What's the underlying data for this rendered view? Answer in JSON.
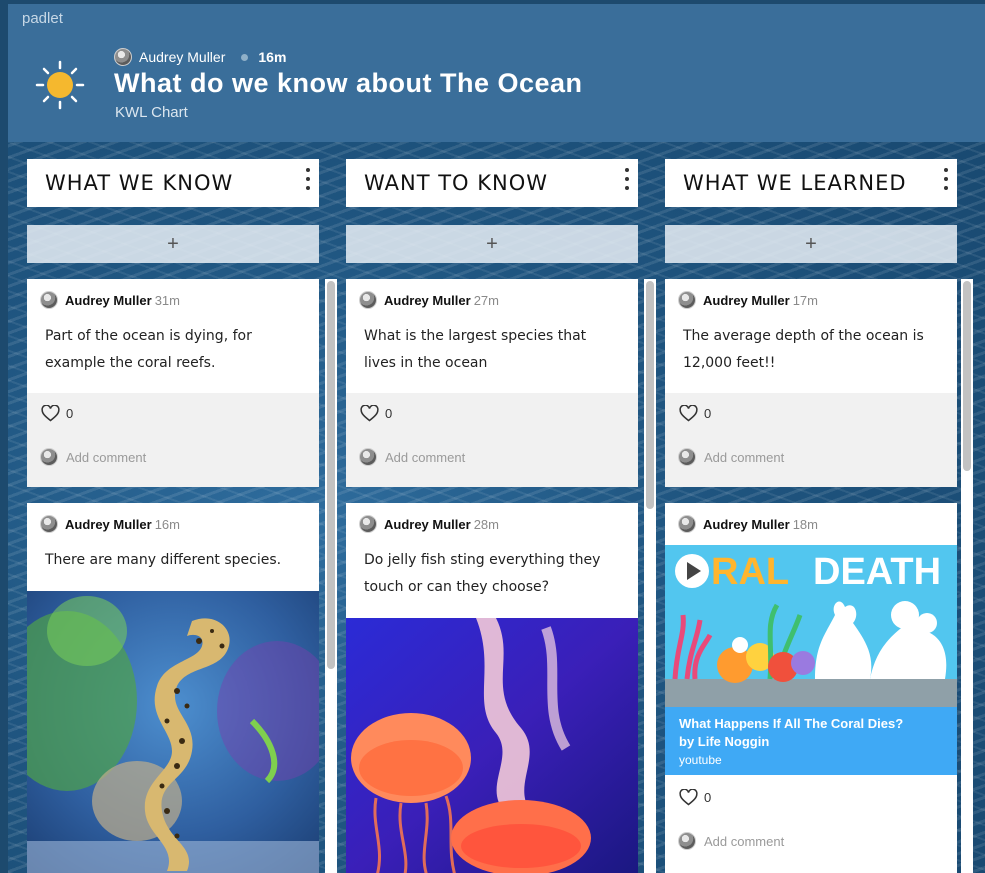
{
  "app": {
    "brand": "padlet"
  },
  "header": {
    "author": "Audrey Muller",
    "time": "16m",
    "title": "What do we know about The Ocean",
    "subtitle": "KWL Chart",
    "icon": "sun-icon"
  },
  "add_label": "+",
  "columns": [
    {
      "title": "WHAT WE KNOW",
      "posts": [
        {
          "author": "Audrey Muller",
          "time": "31m",
          "text": "Part of the ocean is dying, for example the coral reefs.",
          "likes": "0",
          "comment_placeholder": "Add comment"
        },
        {
          "author": "Audrey Muller",
          "time": "16m",
          "text": "There are many different species.",
          "image": "seahorse-photo"
        }
      ]
    },
    {
      "title": "WANT TO KNOW",
      "posts": [
        {
          "author": "Audrey Muller",
          "time": "27m",
          "text": "What is the largest species that lives in the ocean",
          "likes": "0",
          "comment_placeholder": "Add comment"
        },
        {
          "author": "Audrey Muller",
          "time": "28m",
          "text": "Do jelly fish sting everything they touch or can they choose?",
          "image": "jellyfish-photo"
        }
      ]
    },
    {
      "title": "WHAT WE LEARNED",
      "posts": [
        {
          "author": "Audrey Muller",
          "time": "17m",
          "text": "The average depth of the ocean is 12,000 feet!!",
          "likes": "0",
          "comment_placeholder": "Add comment"
        },
        {
          "author": "Audrey Muller",
          "time": "18m",
          "video": {
            "thumb_title_1": "C",
            "thumb_title_2": "RAL",
            "thumb_title_3": "DEATH",
            "title": "What Happens If All The Coral Dies?",
            "by": "by Life Noggin",
            "source": "youtube"
          },
          "likes": "0",
          "comment_placeholder": "Add comment"
        }
      ]
    }
  ],
  "colors": {
    "header": "#3a6e9a",
    "video_bar": "#3fa9f5"
  }
}
